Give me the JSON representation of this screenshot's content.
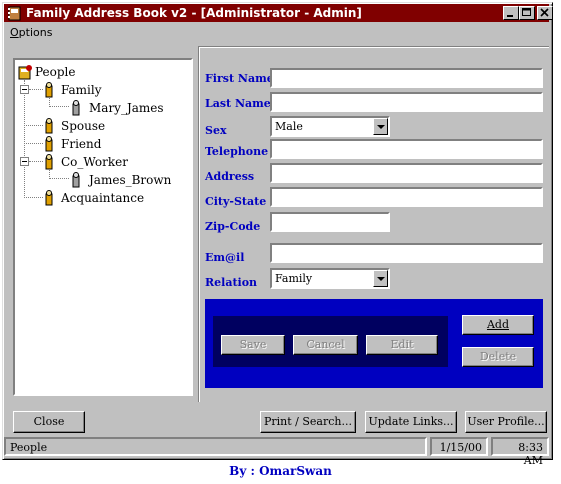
{
  "window": {
    "title": "Family Address Book v2 - [Administrator - Admin]"
  },
  "menu": {
    "options_label": "Options",
    "options_mnemonic": "O",
    "options_rest": "ptions"
  },
  "tree": {
    "root": "People",
    "nodes": [
      {
        "label": "Family",
        "children": [
          "Mary_James"
        ]
      },
      {
        "label": "Spouse",
        "children": []
      },
      {
        "label": "Friend",
        "children": []
      },
      {
        "label": "Co_Worker",
        "children": [
          "James_Brown"
        ]
      },
      {
        "label": "Acquaintance",
        "children": []
      }
    ]
  },
  "form": {
    "first_name_label": "First Name",
    "first_name_value": "",
    "last_name_label": "Last Name",
    "last_name_value": "",
    "sex_label": "Sex",
    "sex_value": "Male",
    "telephone_label": "Telephone",
    "telephone_value": "",
    "address_label": "Address",
    "address_value": "",
    "city_state_label": "City-State",
    "city_state_value": "",
    "zip_label": "Zip-Code",
    "zip_value": "",
    "email_label": "Em@il",
    "email_value": "",
    "relation_label": "Relation",
    "relation_value": "Family"
  },
  "record_buttons": {
    "save": "Save",
    "cancel": "Cancel",
    "edit": "Edit",
    "add": "Add",
    "delete": "Delete"
  },
  "bottom_buttons": {
    "close": "Close",
    "print_search": "Print / Search...",
    "update_links": "Update Links...",
    "user_profile": "User Profile..."
  },
  "status": {
    "text": "People",
    "date": "1/15/00",
    "time": "8:33 AM"
  },
  "byline": "By : OmarSwan",
  "colors": {
    "titlebar": "#800000",
    "label_blue": "#0000c0",
    "panel_blue": "#0000c0",
    "panel_navy": "#000060"
  }
}
